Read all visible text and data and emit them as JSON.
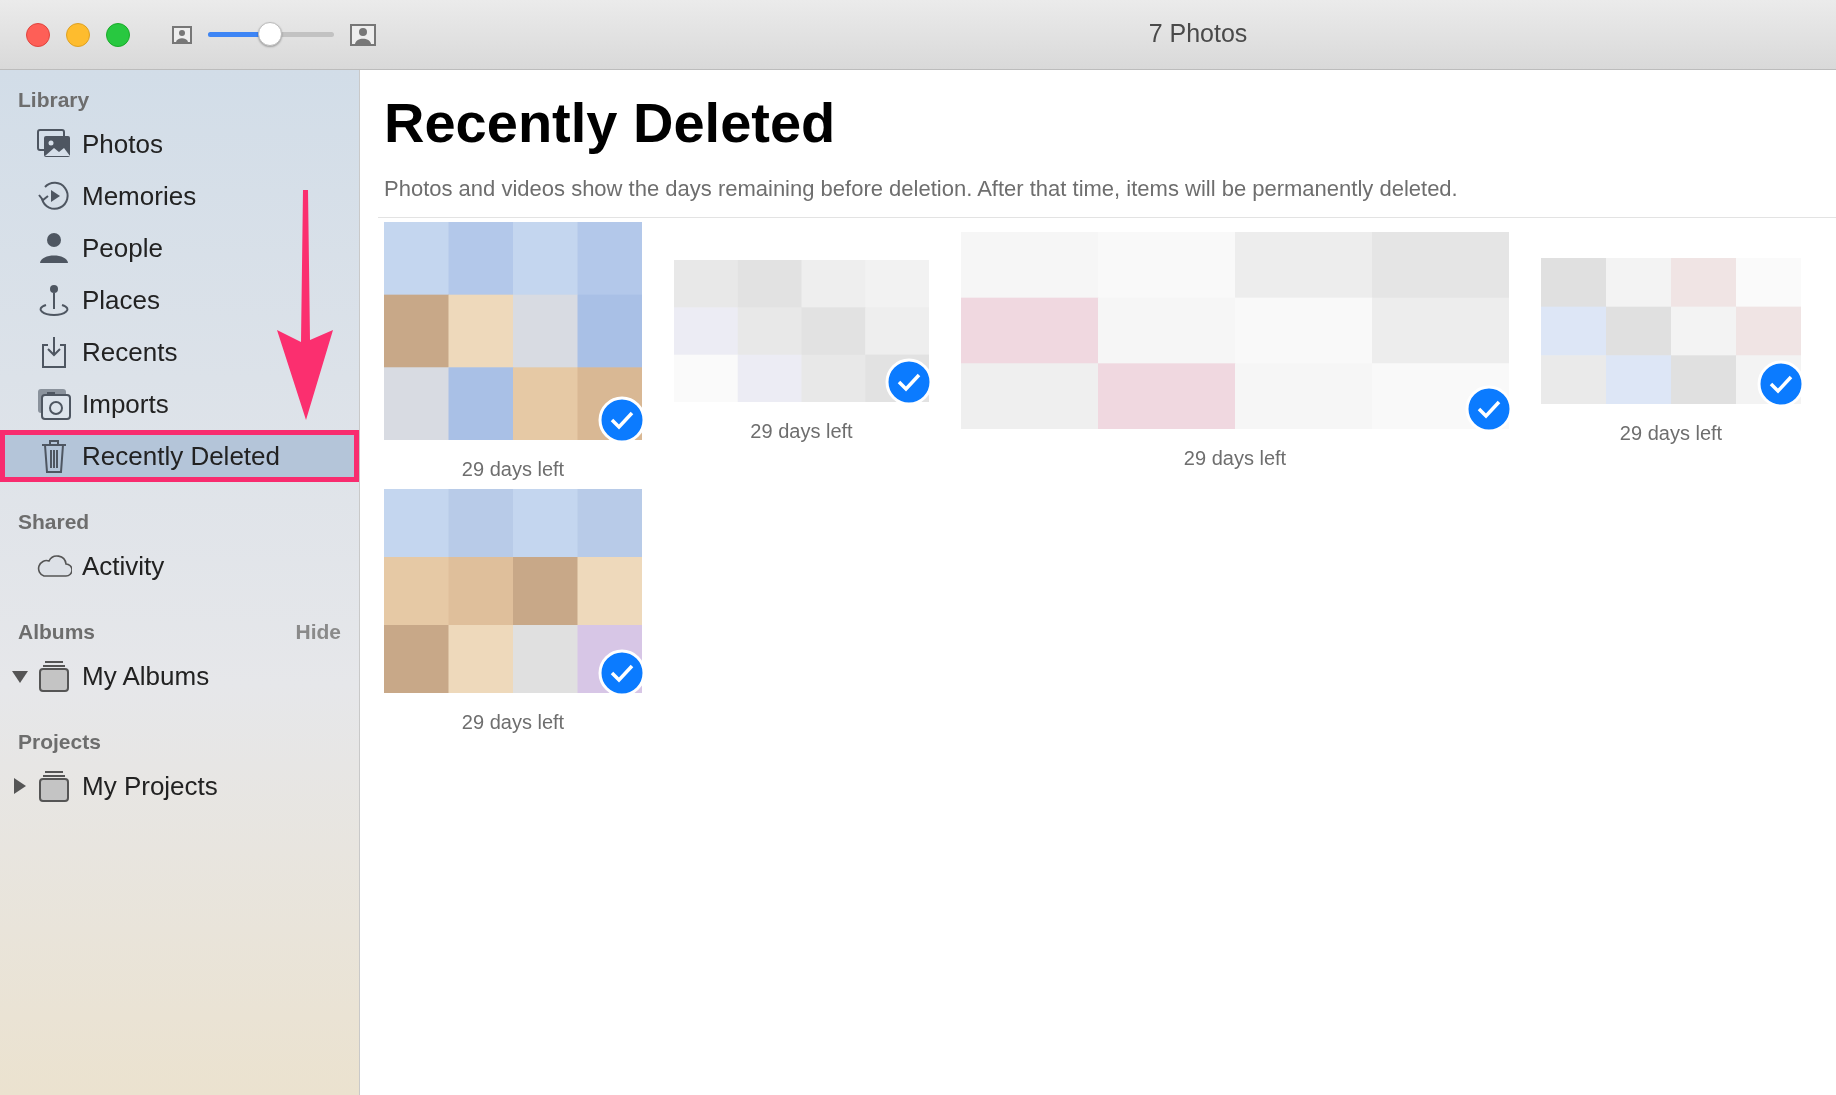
{
  "window": {
    "title": "7 Photos",
    "zoom_slider": {
      "level": 0.49
    }
  },
  "sidebar": {
    "sections": [
      {
        "header": "Library",
        "items": [
          {
            "label": "Photos",
            "selected": false,
            "highlighted": false
          },
          {
            "label": "Memories",
            "selected": false,
            "highlighted": false
          },
          {
            "label": "People",
            "selected": false,
            "highlighted": false
          },
          {
            "label": "Places",
            "selected": false,
            "highlighted": false
          },
          {
            "label": "Recents",
            "selected": false,
            "highlighted": false
          },
          {
            "label": "Imports",
            "selected": false,
            "highlighted": false
          },
          {
            "label": "Recently Deleted",
            "selected": true,
            "highlighted": true
          }
        ]
      },
      {
        "header": "Shared",
        "items": [
          {
            "label": "Activity",
            "selected": false,
            "highlighted": false
          }
        ]
      },
      {
        "header": "Albums",
        "action": "Hide",
        "items": [
          {
            "label": "My Albums",
            "selected": false,
            "highlighted": false,
            "expanded": true
          }
        ]
      },
      {
        "header": "Projects",
        "items": [
          {
            "label": "My Projects",
            "selected": false,
            "highlighted": false,
            "expanded": false
          }
        ]
      }
    ],
    "annotation_arrow": true
  },
  "main": {
    "title": "Recently Deleted",
    "description": "Photos and videos show the days remaining before deletion. After that time, items will be permanently deleted.",
    "photos": [
      {
        "kind": "picture",
        "selected": true,
        "caption": "29 days left"
      },
      {
        "kind": "picture",
        "selected": true,
        "caption": "29 days left"
      },
      {
        "kind": "picture",
        "selected": true,
        "caption": "29 days left"
      },
      {
        "kind": "picture",
        "selected": true,
        "caption": "29 days left"
      },
      {
        "kind": "picture",
        "selected": true,
        "caption": "29 days left"
      }
    ]
  }
}
